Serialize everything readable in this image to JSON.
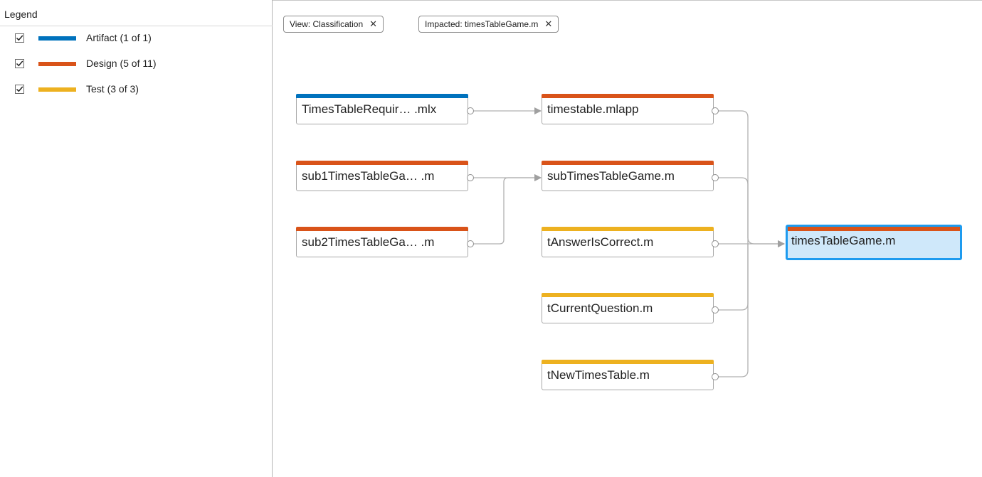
{
  "colors": {
    "artifact": "#0072bd",
    "design": "#d95319",
    "test": "#edb120",
    "selection_border": "#1e9bef",
    "selection_fill": "#cfe8fa",
    "edge": "#b0b0b0"
  },
  "legend": {
    "title": "Legend",
    "items": [
      {
        "label": "Artifact (1 of 1)",
        "checked": true,
        "color": "#0072bd"
      },
      {
        "label": "Design (5 of 11)",
        "checked": true,
        "color": "#d95319"
      },
      {
        "label": "Test (3 of 3)",
        "checked": true,
        "color": "#edb120"
      }
    ]
  },
  "filters": [
    {
      "label": "View: Classification",
      "remove": "✕"
    },
    {
      "label": "Impacted: timesTableGame.m",
      "remove": "✕"
    }
  ],
  "graph": {
    "nodes": [
      {
        "id": "n1",
        "label": "TimesTableRequir… .mlx",
        "category": "artifact"
      },
      {
        "id": "n2",
        "label": "sub1TimesTableGa… .m",
        "category": "design"
      },
      {
        "id": "n3",
        "label": "sub2TimesTableGa… .m",
        "category": "design"
      },
      {
        "id": "n4",
        "label": "timestable.mlapp",
        "category": "design"
      },
      {
        "id": "n5",
        "label": "subTimesTableGame.m",
        "category": "design"
      },
      {
        "id": "n6",
        "label": "tAnswerIsCorrect.m",
        "category": "test"
      },
      {
        "id": "n7",
        "label": "tCurrentQuestion.m",
        "category": "test"
      },
      {
        "id": "n8",
        "label": "tNewTimesTable.m",
        "category": "test"
      },
      {
        "id": "n9",
        "label": "timesTableGame.m",
        "category": "design",
        "selected": true
      }
    ]
  }
}
